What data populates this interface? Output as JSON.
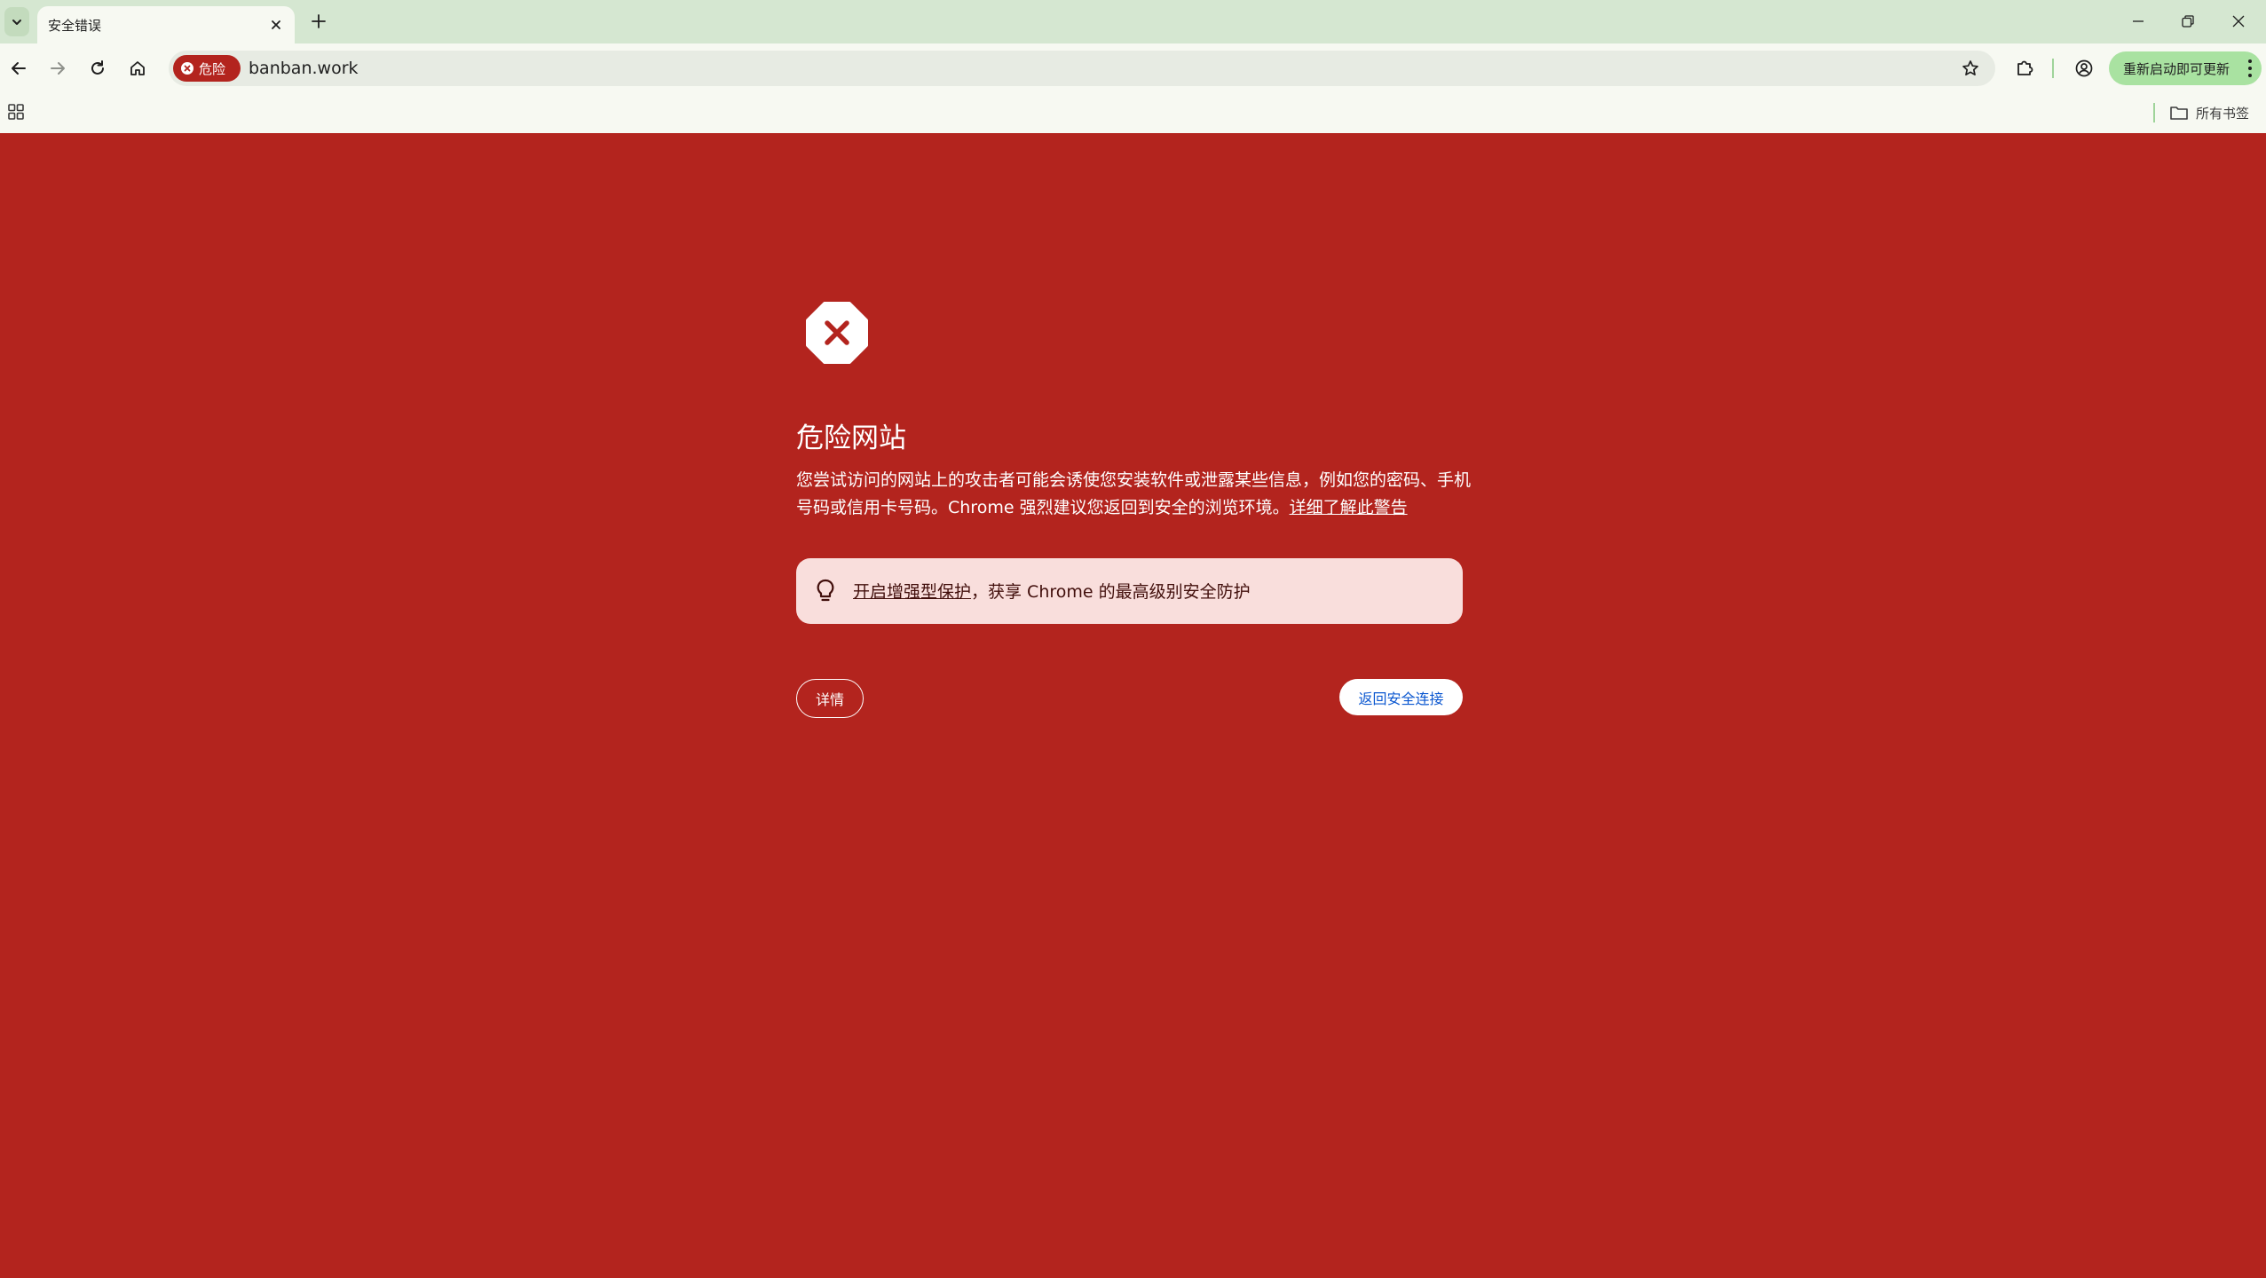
{
  "browser": {
    "tab": {
      "title": "安全错误"
    },
    "omnibox": {
      "security_chip": "危险",
      "url": "banban.work"
    },
    "update_button": "重新启动即可更新",
    "bookmarks_bar": {
      "all_bookmarks": "所有书签"
    }
  },
  "interstitial": {
    "heading": "危险网站",
    "description": "您尝试访问的网站上的攻击者可能会诱使您安装软件或泄露某些信息，例如您的密码、手机号码或信用卡号码。Chrome 强烈建议您返回到安全的浏览环境。",
    "learn_more_link": "详细了解此警告",
    "enhanced_protection": {
      "link_text": "开启增强型保护",
      "rest_text": "，获享 Chrome 的最高级别安全防护"
    },
    "details_button": "详情",
    "back_button": "返回安全连接"
  },
  "colors": {
    "danger_red": "#b3241e",
    "tab_strip": "#d5e7d1",
    "toolbar": "#f7f9f2",
    "update_button": "#a9e2a1",
    "enhanced_box": "#f9dedc",
    "link_blue": "#0b57d0"
  }
}
